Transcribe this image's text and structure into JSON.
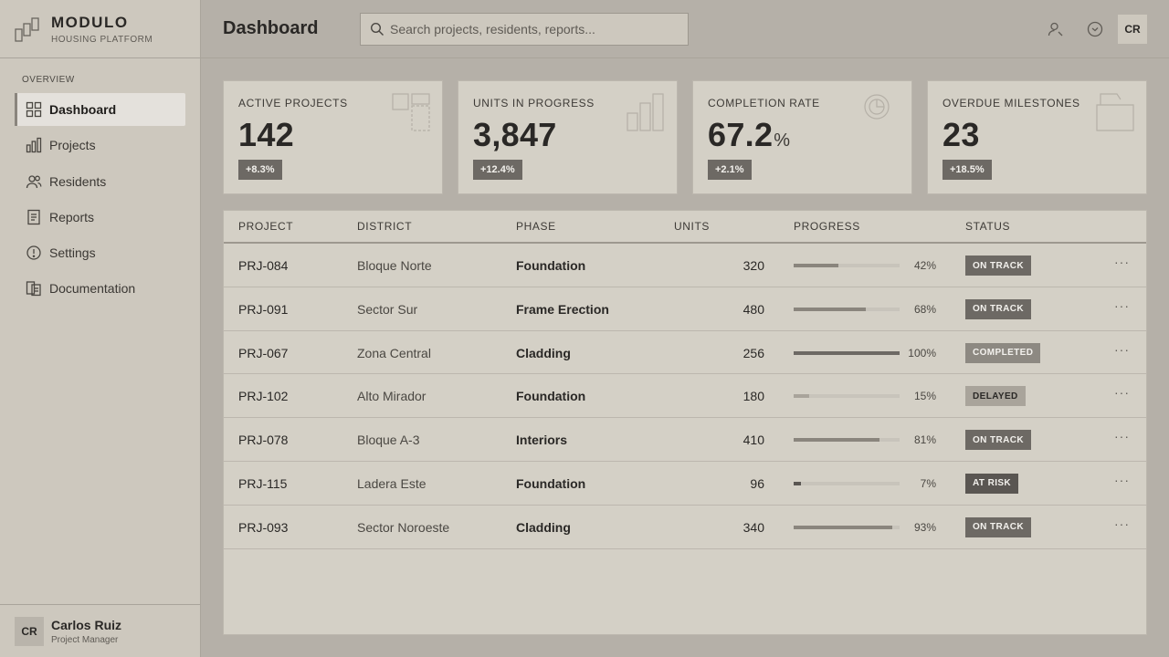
{
  "brand": {
    "title": "MODULO",
    "subtitle": "HOUSING PLATFORM"
  },
  "sidebar": {
    "section": "OVERVIEW",
    "items": [
      {
        "label": "Dashboard",
        "icon": "grid-icon",
        "active": true
      },
      {
        "label": "Projects",
        "icon": "bar-chart-icon"
      },
      {
        "label": "Residents",
        "icon": "users-icon"
      },
      {
        "label": "Reports",
        "icon": "document-icon"
      },
      {
        "label": "Settings",
        "icon": "info-circle-icon"
      },
      {
        "label": "Documentation",
        "icon": "docs-icon"
      }
    ]
  },
  "user": {
    "initials": "CR",
    "name": "Carlos Ruiz",
    "role": "Project Manager"
  },
  "header": {
    "title": "Dashboard",
    "search_placeholder": "Search projects, residents, reports...",
    "avatar_initials": "CR"
  },
  "kpis": [
    {
      "label": "ACTIVE PROJECTS",
      "value": "142",
      "unit": "",
      "change": "+8.3%"
    },
    {
      "label": "UNITS IN PROGRESS",
      "value": "3,847",
      "unit": "",
      "change": "+12.4%"
    },
    {
      "label": "COMPLETION RATE",
      "value": "67.2",
      "unit": "%",
      "change": "+2.1%"
    },
    {
      "label": "OVERDUE MILESTONES",
      "value": "23",
      "unit": "",
      "change": "+18.5%"
    }
  ],
  "table": {
    "headers": [
      "PROJECT",
      "DISTRICT",
      "PHASE",
      "UNITS",
      "PROGRESS",
      "STATUS"
    ],
    "rows": [
      {
        "project": "PRJ-084",
        "district": "Bloque Norte",
        "phase": "Foundation",
        "units": "320",
        "progress": 42,
        "progress_label": "42%",
        "status": "ON TRACK",
        "status_kind": "on"
      },
      {
        "project": "PRJ-091",
        "district": "Sector Sur",
        "phase": "Frame Erection",
        "units": "480",
        "progress": 68,
        "progress_label": "68%",
        "status": "ON TRACK",
        "status_kind": "on"
      },
      {
        "project": "PRJ-067",
        "district": "Zona Central",
        "phase": "Cladding",
        "units": "256",
        "progress": 100,
        "progress_label": "100%",
        "status": "COMPLETED",
        "status_kind": "done"
      },
      {
        "project": "PRJ-102",
        "district": "Alto Mirador",
        "phase": "Foundation",
        "units": "180",
        "progress": 15,
        "progress_label": "15%",
        "status": "DELAYED",
        "status_kind": "delay"
      },
      {
        "project": "PRJ-078",
        "district": "Bloque A-3",
        "phase": "Interiors",
        "units": "410",
        "progress": 81,
        "progress_label": "81%",
        "status": "ON TRACK",
        "status_kind": "on"
      },
      {
        "project": "PRJ-115",
        "district": "Ladera Este",
        "phase": "Foundation",
        "units": "96",
        "progress": 7,
        "progress_label": "7%",
        "status": "AT RISK",
        "status_kind": "risk"
      },
      {
        "project": "PRJ-093",
        "district": "Sector Noroeste",
        "phase": "Cladding",
        "units": "340",
        "progress": 93,
        "progress_label": "93%",
        "status": "ON TRACK",
        "status_kind": "on"
      }
    ],
    "row_action": "···"
  }
}
